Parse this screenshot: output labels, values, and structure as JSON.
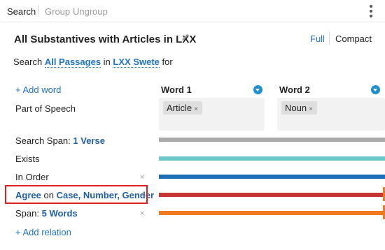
{
  "toolbar": {
    "search": "Search",
    "group": "Group",
    "ungroup": "Ungroup"
  },
  "header": {
    "title": "All Substantives with Articles in LXX",
    "view_full": "Full",
    "view_compact": "Compact"
  },
  "scope": {
    "prefix": "Search",
    "passages": "All Passages",
    "in": "in",
    "version": "LXX Swete",
    "suffix": "for"
  },
  "add_word": "+ Add word",
  "part_of_speech": "Part of Speech",
  "words": [
    {
      "heading": "Word 1",
      "chip": "Article"
    },
    {
      "heading": "Word 2",
      "chip": "Noun"
    }
  ],
  "chip_remove": "×",
  "relations": {
    "search_span_label": "Search Span:",
    "search_span_value": "1 Verse",
    "exists": "Exists",
    "in_order": "In Order",
    "agree": "Agree",
    "agree_on": "on",
    "agree_value": "Case, Number, Gender",
    "span_label": "Span:",
    "span_value": "5 Words",
    "remove": "×",
    "add_relation": "+ Add relation"
  },
  "colors": {
    "link": "#1e74c8",
    "search_span_bar": "#a9a9a9",
    "exists_bar": "#6cc8c8",
    "in_order_bar": "#1a6fb4",
    "agree_bar": "#c73636",
    "span_bar": "#f07a1f",
    "highlight": "#e02020"
  }
}
